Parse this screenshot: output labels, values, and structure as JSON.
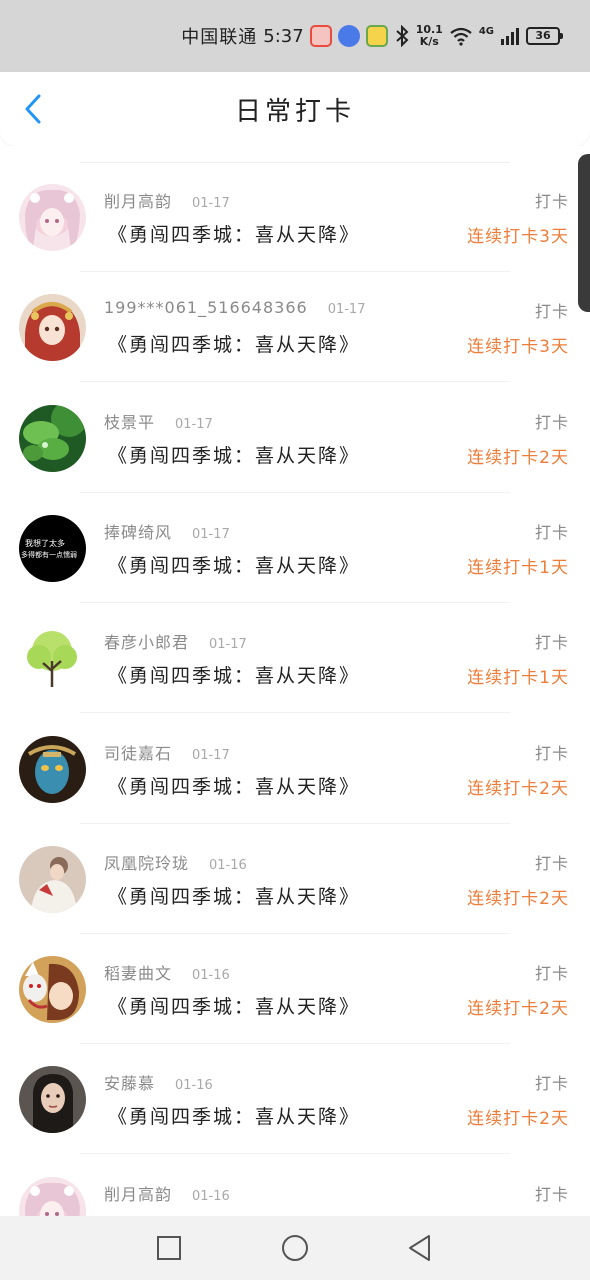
{
  "status_bar": {
    "carrier": "中国联通",
    "time": "5:37",
    "net_speed_value": "10.1",
    "net_speed_unit": "K/s",
    "network": "4G",
    "battery": "36"
  },
  "header": {
    "title": "日常打卡"
  },
  "colors": {
    "accent": "#ef7d3a",
    "back_icon": "#2196f3",
    "name_text": "#8a8a8a",
    "content_text": "#222222"
  },
  "records": [
    {
      "name": "削月高韵",
      "date": "01-17",
      "content": "《勇闯四季城：喜从天降》",
      "type": "打卡",
      "streak": "连续打卡3天",
      "avatar": "avatar-pink-anime-girl"
    },
    {
      "name": "199***061_516648366",
      "date": "01-17",
      "content": "《勇闯四季城：喜从天降》",
      "type": "打卡",
      "streak": "连续打卡3天",
      "avatar": "avatar-red-costume-girl"
    },
    {
      "name": "枝景平",
      "date": "01-17",
      "content": "《勇闯四季城：喜从天降》",
      "type": "打卡",
      "streak": "连续打卡2天",
      "avatar": "avatar-green-clover"
    },
    {
      "name": "捧碑绮风",
      "date": "01-17",
      "content": "《勇闯四季城：喜从天降》",
      "type": "打卡",
      "streak": "连续打卡1天",
      "avatar": "avatar-text-on-black",
      "avatar_text_1": "我想了太多",
      "avatar_text_2": "多得都有一点懦弱"
    },
    {
      "name": "春彦小郎君",
      "date": "01-17",
      "content": "《勇闯四季城：喜从天降》",
      "type": "打卡",
      "streak": "连续打卡1天",
      "avatar": "avatar-green-tree"
    },
    {
      "name": "司徒嘉石",
      "date": "01-17",
      "content": "《勇闯四季城：喜从天降》",
      "type": "打卡",
      "streak": "连续打卡2天",
      "avatar": "avatar-blue-face"
    },
    {
      "name": "凤凰院玲珑",
      "date": "01-16",
      "content": "《勇闯四季城：喜从天降》",
      "type": "打卡",
      "streak": "连续打卡2天",
      "avatar": "avatar-woman-white"
    },
    {
      "name": "稻妻曲文",
      "date": "01-16",
      "content": "《勇闯四季城：喜从天降》",
      "type": "打卡",
      "streak": "连续打卡2天",
      "avatar": "avatar-mask-anime"
    },
    {
      "name": "安藤慕",
      "date": "01-16",
      "content": "《勇闯四季城：喜从天降》",
      "type": "打卡",
      "streak": "连续打卡2天",
      "avatar": "avatar-woman-dark"
    },
    {
      "name": "削月高韵",
      "date": "01-16",
      "content": "",
      "type": "打卡",
      "streak": "",
      "avatar": "avatar-pink-anime-girl"
    }
  ],
  "bottom_nav": {
    "recents": "square-icon",
    "home": "circle-icon",
    "back": "triangle-back-icon"
  }
}
